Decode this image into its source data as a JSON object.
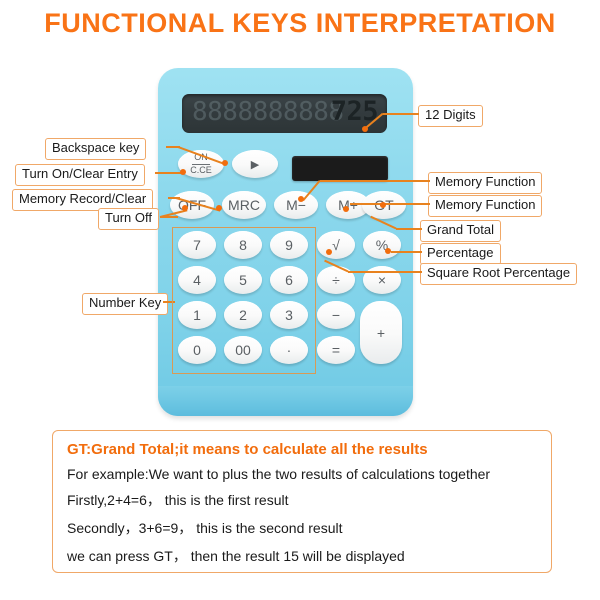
{
  "page": {
    "title": "FUNCTIONAL KEYS INTERPRETATION",
    "accent_color": "#f97316",
    "callout_border_color": "#f0a868",
    "connector_color": "#e8821e",
    "calculator_body_color": "#8ad7ec",
    "key_color": "#ffffff"
  },
  "calculator": {
    "display": {
      "ghost_digits": "8888888888",
      "value": "725"
    },
    "solar_panel": "solar-panel",
    "keys": {
      "on_ce_top": "ON",
      "on_ce_bottom": "C.CE",
      "backspace": "▶",
      "off": "OFF",
      "mrc": "MRC",
      "m_minus": "M−",
      "m_plus": "M+",
      "gt": "GT",
      "seven": "7",
      "eight": "8",
      "nine": "9",
      "sqrt": "√",
      "percent": "%",
      "four": "4",
      "five": "5",
      "six": "6",
      "divide": "÷",
      "multiply": "×",
      "one": "1",
      "two": "2",
      "three": "3",
      "minus": "−",
      "plus": "+",
      "zero": "0",
      "double_zero": "00",
      "dot": "·",
      "equals": "="
    }
  },
  "callouts": {
    "left": [
      {
        "text": "Backspace key"
      },
      {
        "text": "Turn On/Clear Entry"
      },
      {
        "text": "Memory Record/Clear"
      },
      {
        "text": "Turn Off"
      },
      {
        "text": "Number Key"
      }
    ],
    "right": [
      {
        "text": "12 Digits"
      },
      {
        "text": "Memory Function"
      },
      {
        "text": "Memory Function"
      },
      {
        "text": "Grand Total"
      },
      {
        "text": "Percentage"
      },
      {
        "text": "Square Root Percentage"
      }
    ]
  },
  "info_box": {
    "heading": "GT:Grand Total;it means to calculate all the results",
    "lines": [
      "For example:We want to plus the two  results of calculations together",
      "Firstly,2+4=6， this is the first result",
      "Secondly，3+6=9， this is the second result",
      "we can press GT， then the result 15 will be displayed"
    ]
  }
}
